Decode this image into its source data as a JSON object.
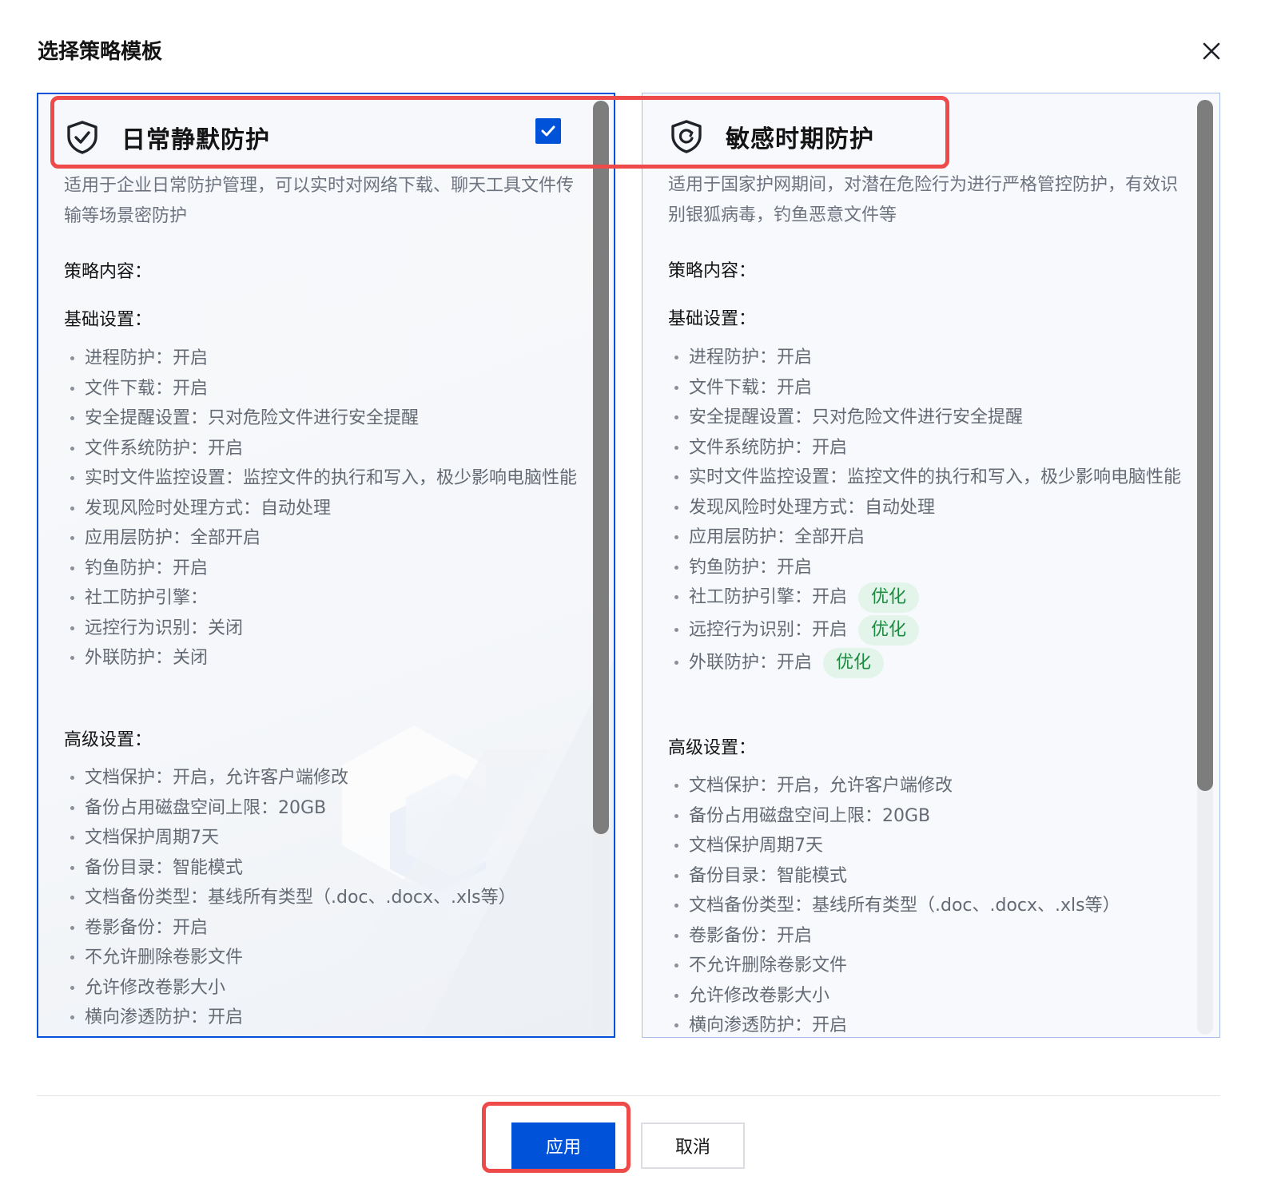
{
  "dialog": {
    "title": "选择策略模板",
    "close_icon": "close-icon"
  },
  "left_card": {
    "title": "日常静默防护",
    "selected": true,
    "description": "适用于企业日常防护管理，可以实时对网络下载、聊天工具文件传输等场景密防护",
    "content_heading": "策略内容：",
    "basic_heading": "基础设置：",
    "basic_items": [
      {
        "text": "进程防护：开启"
      },
      {
        "text": "文件下载：开启"
      },
      {
        "text": "安全提醒设置：只对危险文件进行安全提醒"
      },
      {
        "text": "文件系统防护：开启"
      },
      {
        "text": "实时文件监控设置：监控文件的执行和写入，极少影响电脑性能"
      },
      {
        "text": "发现风险时处理方式：自动处理"
      },
      {
        "text": "应用层防护：全部开启"
      },
      {
        "text": "钓鱼防护：开启"
      },
      {
        "text": "社工防护引擎："
      },
      {
        "text": "远控行为识别：关闭"
      },
      {
        "text": "外联防护：关闭"
      }
    ],
    "advanced_heading": "高级设置：",
    "advanced_items": [
      {
        "text": "文档保护：开启，允许客户端修改"
      },
      {
        "text": "备份占用磁盘空间上限：20GB"
      },
      {
        "text": "文档保护周期7天"
      },
      {
        "text": "备份目录：智能模式"
      },
      {
        "text": "文档备份类型：基线所有类型（.doc、.docx、.xls等）"
      },
      {
        "text": "卷影备份：开启"
      },
      {
        "text": "不允许删除卷影文件"
      },
      {
        "text": "允许修改卷影大小"
      },
      {
        "text": "横向渗透防护：开启"
      }
    ]
  },
  "right_card": {
    "title": "敏感时期防护",
    "description": "适用于国家护网期间，对潜在危险行为进行严格管控防护，有效识别银狐病毒，钓鱼恶意文件等",
    "content_heading": "策略内容：",
    "basic_heading": "基础设置：",
    "basic_items": [
      {
        "text": "进程防护：开启"
      },
      {
        "text": "文件下载：开启"
      },
      {
        "text": "安全提醒设置：只对危险文件进行安全提醒"
      },
      {
        "text": "文件系统防护：开启"
      },
      {
        "text": "实时文件监控设置：监控文件的执行和写入，极少影响电脑性能"
      },
      {
        "text": "发现风险时处理方式：自动处理"
      },
      {
        "text": "应用层防护：全部开启"
      },
      {
        "text": "钓鱼防护：开启"
      },
      {
        "text": "社工防护引擎：开启",
        "tag": "优化"
      },
      {
        "text": "远控行为识别：开启",
        "tag": "优化"
      },
      {
        "text": "外联防护：开启",
        "tag": "优化"
      }
    ],
    "advanced_heading": "高级设置：",
    "advanced_items": [
      {
        "text": "文档保护：开启，允许客户端修改"
      },
      {
        "text": "备份占用磁盘空间上限：20GB"
      },
      {
        "text": "文档保护周期7天"
      },
      {
        "text": "备份目录：智能模式"
      },
      {
        "text": "文档备份类型：基线所有类型（.doc、.docx、.xls等）"
      },
      {
        "text": "卷影备份：开启"
      },
      {
        "text": "不允许删除卷影文件"
      },
      {
        "text": "允许修改卷影大小"
      },
      {
        "text": "横向渗透防护：开启"
      }
    ]
  },
  "footer": {
    "apply_label": "应用",
    "cancel_label": "取消"
  },
  "colors": {
    "primary": "#0052d9",
    "tag_bg": "#e3f5ea",
    "tag_text": "#1c8a3f",
    "highlight": "#ef4a4a"
  }
}
